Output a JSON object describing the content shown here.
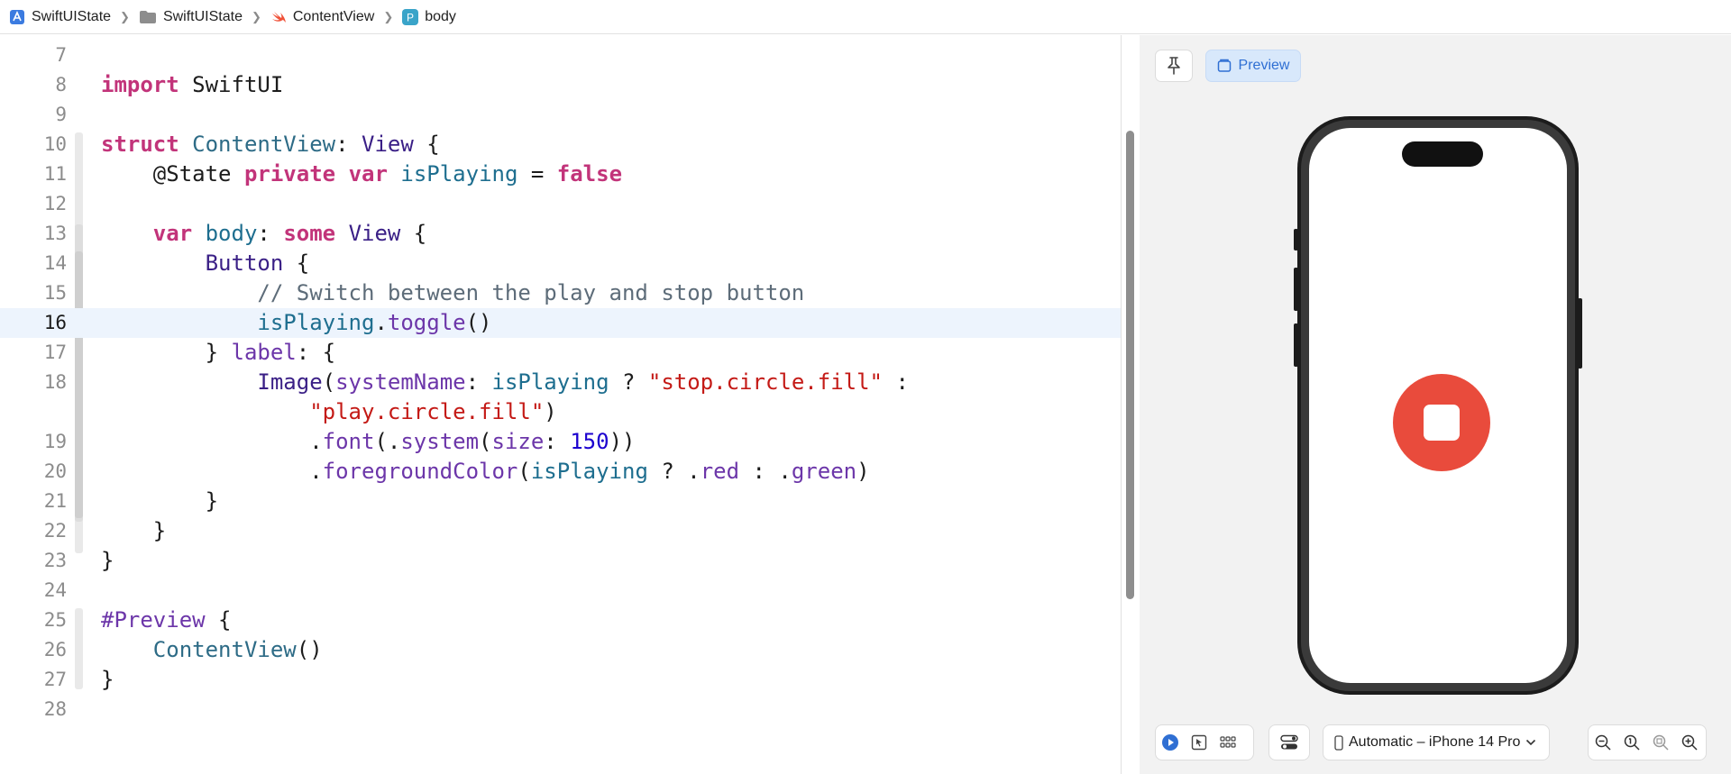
{
  "breadcrumb": {
    "items": [
      {
        "label": "SwiftUIState",
        "icon": "app-project-icon"
      },
      {
        "label": "SwiftUIState",
        "icon": "folder-icon"
      },
      {
        "label": "ContentView",
        "icon": "swift-file-icon"
      },
      {
        "label": "body",
        "icon": "property-icon",
        "badge": "P"
      }
    ]
  },
  "editor": {
    "current_line": "16",
    "lines": [
      {
        "n": "7"
      },
      {
        "n": "8"
      },
      {
        "n": "9"
      },
      {
        "n": "10"
      },
      {
        "n": "11"
      },
      {
        "n": "12"
      },
      {
        "n": "13"
      },
      {
        "n": "14"
      },
      {
        "n": "15"
      },
      {
        "n": "16"
      },
      {
        "n": "17"
      },
      {
        "n": "18"
      },
      {
        "n": ""
      },
      {
        "n": "19"
      },
      {
        "n": "20"
      },
      {
        "n": "21"
      },
      {
        "n": "22"
      },
      {
        "n": "23"
      },
      {
        "n": "24"
      },
      {
        "n": "25"
      },
      {
        "n": "26"
      },
      {
        "n": "27"
      },
      {
        "n": "28"
      }
    ],
    "code": {
      "l8_kw": "import",
      "l8_mod": " SwiftUI",
      "l10_kw": "struct",
      "l10_name": "ContentView",
      "l10_colon": ": ",
      "l10_type": "View",
      "l10_brace": " {",
      "l11_attr": "@State",
      "l11_kw1": "private",
      "l11_kw2": "var",
      "l11_id": "isPlaying",
      "l11_eq": " = ",
      "l11_val": "false",
      "l13_kw": "var",
      "l13_id": "body",
      "l13_colon": ": ",
      "l13_kw2": "some",
      "l13_type": "View",
      "l13_brace": " {",
      "l14_type": "Button",
      "l14_brace": " {",
      "l15_comment": "// Switch between the play and stop button",
      "l16_id": "isPlaying",
      "l16_dot": ".",
      "l16_fn": "toggle",
      "l16_paren": "()",
      "l17_close": "} ",
      "l17_fn": "label",
      "l17_rest": ": {",
      "l18_type": "Image",
      "l18_p1": "(",
      "l18_arg": "systemName",
      "l18_p2": ": ",
      "l18_id": "isPlaying",
      "l18_q": " ? ",
      "l18_str1": "\"stop.circle.fill\"",
      "l18_colon": " :",
      "l18b_str2": "\"play.circle.fill\"",
      "l18b_p": ")",
      "l19_dot": ".",
      "l19_fn": "font",
      "l19_p1": "(.",
      "l19_fn2": "system",
      "l19_p2": "(",
      "l19_arg": "size",
      "l19_c": ": ",
      "l19_num": "150",
      "l19_p3": "))",
      "l20_dot": ".",
      "l20_fn": "foregroundColor",
      "l20_p1": "(",
      "l20_id": "isPlaying",
      "l20_q": " ? .",
      "l20_red": "red",
      "l20_c": " : .",
      "l20_green": "green",
      "l20_p2": ")",
      "l21_brace": "}",
      "l22_brace": "}",
      "l23_brace": "}",
      "l25_dir": "#Preview",
      "l25_brace": " {",
      "l26_type": "ContentView",
      "l26_p": "()",
      "l27_brace": "}"
    }
  },
  "canvas": {
    "pin_icon": "pin-icon",
    "preview_label": "Preview",
    "device_label": "Automatic – iPhone 14 Pro",
    "accent": "#2f6fd3",
    "stop_color": "#e94b3c"
  }
}
